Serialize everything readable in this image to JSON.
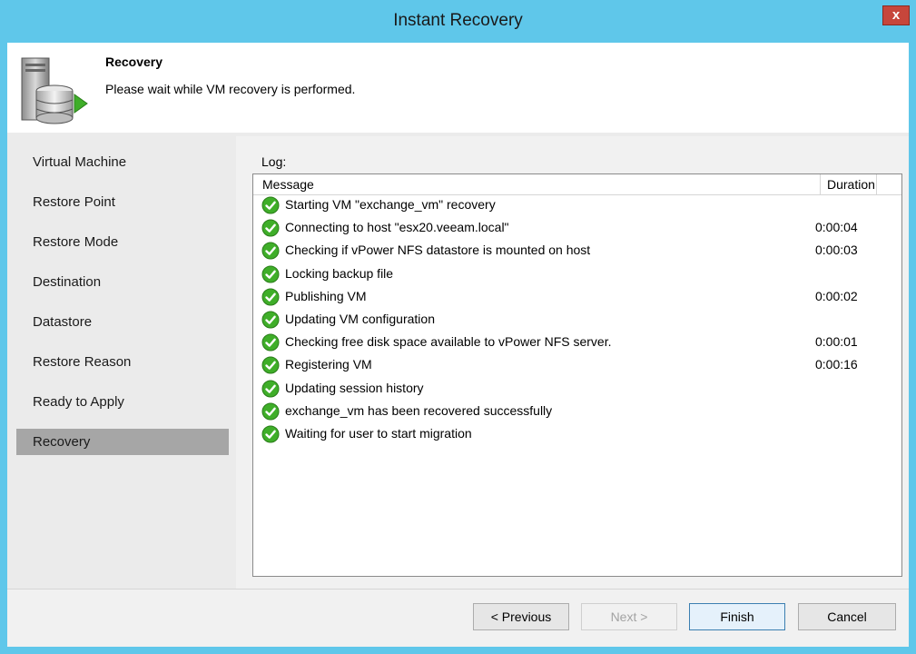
{
  "window": {
    "title": "Instant Recovery",
    "close_label": "x"
  },
  "header": {
    "title": "Recovery",
    "subtitle": "Please wait while VM recovery is performed."
  },
  "nav": {
    "items": [
      {
        "label": "Virtual Machine",
        "active": false
      },
      {
        "label": "Restore Point",
        "active": false
      },
      {
        "label": "Restore Mode",
        "active": false
      },
      {
        "label": "Destination",
        "active": false
      },
      {
        "label": "Datastore",
        "active": false
      },
      {
        "label": "Restore Reason",
        "active": false
      },
      {
        "label": "Ready to Apply",
        "active": false
      },
      {
        "label": "Recovery",
        "active": true
      }
    ]
  },
  "log": {
    "label": "Log:",
    "columns": {
      "message": "Message",
      "duration": "Duration"
    },
    "rows": [
      {
        "message": "Starting VM \"exchange_vm\" recovery",
        "duration": "",
        "status": "success"
      },
      {
        "message": "Connecting to host \"esx20.veeam.local\"",
        "duration": "0:00:04",
        "status": "success"
      },
      {
        "message": "Checking if vPower NFS datastore is mounted on host",
        "duration": "0:00:03",
        "status": "success"
      },
      {
        "message": "Locking backup file",
        "duration": "",
        "status": "success"
      },
      {
        "message": "Publishing VM",
        "duration": "0:00:02",
        "status": "success"
      },
      {
        "message": "Updating VM configuration",
        "duration": "",
        "status": "success"
      },
      {
        "message": "Checking free disk space available to vPower NFS server.",
        "duration": "0:00:01",
        "status": "success"
      },
      {
        "message": "Registering VM",
        "duration": "0:00:16",
        "status": "success"
      },
      {
        "message": "Updating session history",
        "duration": "",
        "status": "success"
      },
      {
        "message": "exchange_vm has been recovered successfully",
        "duration": "",
        "status": "success"
      },
      {
        "message": "Waiting for user to start migration",
        "duration": "",
        "status": "success"
      }
    ]
  },
  "footer": {
    "previous_label": "< Previous",
    "next_label": "Next >",
    "finish_label": "Finish",
    "cancel_label": "Cancel"
  },
  "icons": {
    "row_status": "check-circle-icon",
    "app": "server-database-play-icon"
  },
  "colors": {
    "title_bar": "#5fc7ea",
    "check_green": "#3fae29",
    "nav_active": "#a6a6a6",
    "close_red": "#c7463b"
  }
}
